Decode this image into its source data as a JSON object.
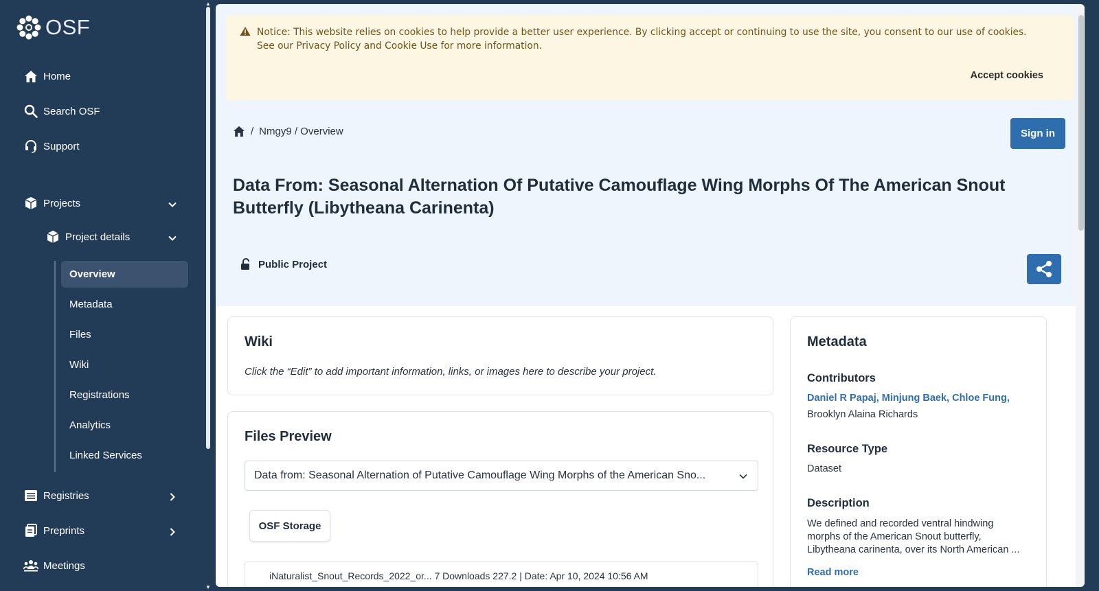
{
  "brand": {
    "name": "OSF"
  },
  "sidebar": {
    "home": "Home",
    "search": "Search OSF",
    "support": "Support",
    "projects": "Projects",
    "project_details": "Project details",
    "sub_items": [
      "Overview",
      "Metadata",
      "Files",
      "Wiki",
      "Registrations",
      "Analytics",
      "Linked Services"
    ],
    "registries": "Registries",
    "preprints": "Preprints",
    "meetings": "Meetings"
  },
  "notice": {
    "text": "Notice: This website relies on cookies to help provide a better user experience. By clicking accept or continuing to use the site, you consent to our use of cookies. See our Privacy Policy and Cookie Use for more information.",
    "accept_label": "Accept cookies"
  },
  "breadcrumb": {
    "separator": "/",
    "path": "Nmgy9 / Overview"
  },
  "header": {
    "signin_label": "Sign in",
    "title": "Data From: Seasonal Alternation Of Putative Camouflage Wing Morphs Of The American Snout Butterfly (Libytheana Carinenta)",
    "visibility": "Public Project"
  },
  "wiki": {
    "title": "Wiki",
    "placeholder_text": "Click the “Edit” to add important information, links, or images here to describe your project."
  },
  "files_preview": {
    "title": "Files Preview",
    "selected_project": "Data from: Seasonal Alternation of Putative Camouflage Wing Morphs of the American Sno...",
    "storage_label": "OSF Storage",
    "first_file_row": "iNaturalist_Snout_Records_2022_or...      7 Downloads            227.2 | Date: Apr 10, 2024 10:56 AM"
  },
  "metadata": {
    "title": "Metadata",
    "contributors_label": "Contributors",
    "contributors_links": "Daniel R Papaj, Minjung Baek, Chloe Fung,",
    "contributors_rest": "Brooklyn Alaina Richards",
    "resource_type_label": "Resource Type",
    "resource_type": "Dataset",
    "description_label": "Description",
    "description": "We defined and recorded ventral hindwing morphs of the American Snout butterfly, Libytheana carinenta, over its North American ...",
    "read_more": "Read more"
  },
  "colors": {
    "sidebar_bg": "#223b56",
    "primary": "#2f6eae",
    "notice_bg": "#fdf6e3",
    "header_bg": "#eef5fc"
  }
}
